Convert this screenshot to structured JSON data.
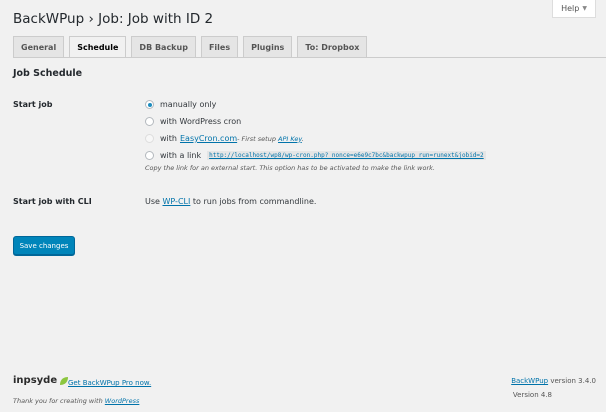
{
  "help": {
    "label": "Help",
    "caret": "▼"
  },
  "title": {
    "app": "BackWPup",
    "separator": "›",
    "job": "Job: Job with ID 2"
  },
  "tabs": [
    {
      "label": "General",
      "active": false
    },
    {
      "label": "Schedule",
      "active": true
    },
    {
      "label": "DB Backup",
      "active": false
    },
    {
      "label": "Files",
      "active": false
    },
    {
      "label": "Plugins",
      "active": false
    },
    {
      "label": "To: Dropbox",
      "active": false
    }
  ],
  "section_title": "Job Schedule",
  "start_job": {
    "label": "Start job",
    "options": {
      "manual": "manually only",
      "wpcron": "with WordPress cron",
      "easycron_prefix": "with",
      "easycron_link": "EasyCron.com",
      "easycron_note_prefix": " - First setup ",
      "easycron_note_link": "API Key",
      "easycron_note_suffix": ".",
      "link_prefix": "with a link",
      "link_url": "http://localhost/wp8/wp-cron.php?_nonce=e6e9c7bc&backwpup_run=runext&jobid=2"
    },
    "description": "Copy the link for an external start. This option has to be activated to make the link work."
  },
  "cli": {
    "label": "Start job with CLI",
    "prefix": "Use ",
    "link": "WP-CLI",
    "suffix": " to run jobs from commandline."
  },
  "save_button": "Save changes",
  "footer": {
    "logo_text": "inpsyde",
    "pro_link": "Get BackWPup Pro now.",
    "thanks_prefix": "Thank you for creating with ",
    "thanks_link": "WordPress",
    "version_link": "BackWPup",
    "version_text": " version 3.4.0",
    "wp_version": "Version 4.8"
  },
  "colors": {
    "accent": "#0073aa",
    "button": "#0085ba",
    "logo_leaf": "#8cc63f"
  }
}
